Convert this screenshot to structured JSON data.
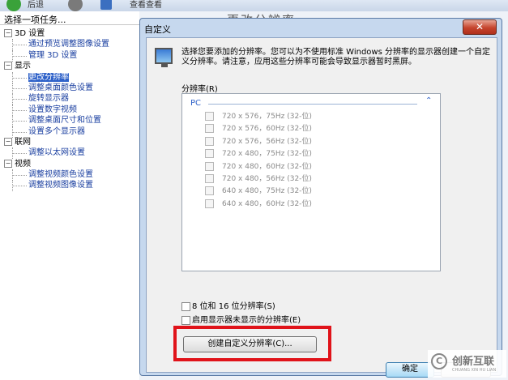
{
  "toolbar": {
    "back_label": "后退",
    "view_label": "查看查看"
  },
  "background_title": "更改分辨率",
  "sidebar": {
    "header": "选择一项任务...",
    "tree": [
      {
        "kind": "group",
        "label": "3D 设置"
      },
      {
        "kind": "item",
        "label": "通过预览调整图像设置"
      },
      {
        "kind": "item",
        "label": "管理 3D 设置"
      },
      {
        "kind": "group",
        "label": "显示"
      },
      {
        "kind": "item",
        "label": "更改分辨率",
        "selected": true
      },
      {
        "kind": "item",
        "label": "调整桌面颜色设置"
      },
      {
        "kind": "item",
        "label": "旋转显示器"
      },
      {
        "kind": "item",
        "label": "设置数字视频"
      },
      {
        "kind": "item",
        "label": "调整桌面尺寸和位置"
      },
      {
        "kind": "item",
        "label": "设置多个显示器"
      },
      {
        "kind": "group",
        "label": "联网"
      },
      {
        "kind": "item",
        "label": "调整以太网设置"
      },
      {
        "kind": "group",
        "label": "视频"
      },
      {
        "kind": "item",
        "label": "调整视频颜色设置"
      },
      {
        "kind": "item",
        "label": "调整视频图像设置"
      }
    ]
  },
  "dialog": {
    "title": "自定义",
    "close_label": "✕",
    "description": "选择您要添加的分辨率。您可以为不使用标准 Windows 分辨率的显示器创建一个自定义分辨率。请注意，应用这些分辨率可能会导致显示器暂时黑屏。",
    "resolution_label": "分辨率(R)",
    "list_group": "PC",
    "resolutions": [
      "720 x 576，75Hz (32-位)",
      "720 x 576，60Hz (32-位)",
      "720 x 576，56Hz (32-位)",
      "720 x 480，75Hz (32-位)",
      "720 x 480，60Hz (32-位)",
      "720 x 480，56Hz (32-位)",
      "640 x 480，75Hz (32-位)",
      "640 x 480，60Hz (32-位)"
    ],
    "option_8_16_bit": "8 位和 16 位分辨率(S)",
    "option_hidden": "启用显示器未显示的分辨率(E)",
    "create_button": "创建自定义分辨率(C)...",
    "ok_button": "确定",
    "cancel_button": ""
  },
  "watermark": {
    "text": "创新互联",
    "sub": "CHUANG XIN HU LIAN"
  },
  "colors": {
    "highlight": "#e0131a",
    "selection": "#2f62c9",
    "link": "#1a3fa0"
  }
}
